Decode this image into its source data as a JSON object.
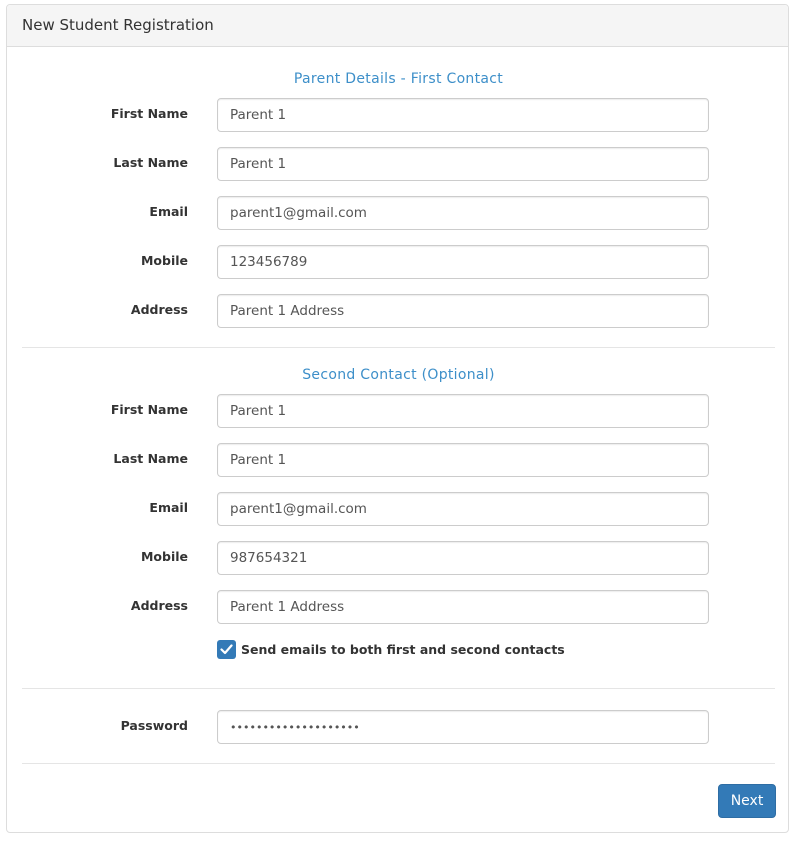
{
  "panel": {
    "title": "New Student Registration"
  },
  "first_contact": {
    "title": "Parent Details - First Contact",
    "fields": [
      {
        "label": "First Name",
        "value": "Parent 1"
      },
      {
        "label": "Last Name",
        "value": "Parent 1"
      },
      {
        "label": "Email",
        "value": "parent1@gmail.com"
      },
      {
        "label": "Mobile",
        "value": "123456789"
      },
      {
        "label": "Address",
        "value": "Parent 1 Address"
      }
    ]
  },
  "second_contact": {
    "title": "Second Contact (Optional)",
    "fields": [
      {
        "label": "First Name",
        "value": "Parent 1"
      },
      {
        "label": "Last Name",
        "value": "Parent 1"
      },
      {
        "label": "Email",
        "value": "parent1@gmail.com"
      },
      {
        "label": "Mobile",
        "value": "987654321"
      },
      {
        "label": "Address",
        "value": "Parent 1 Address"
      }
    ],
    "send_both": {
      "label": "Send emails to both first and second contacts",
      "checked": true
    }
  },
  "password": {
    "label": "Password",
    "value": "••••••••••••••••••••"
  },
  "next_button": {
    "label": "Next"
  },
  "colors": {
    "accent": "#337ab7",
    "section_title": "#3d8fc9"
  }
}
